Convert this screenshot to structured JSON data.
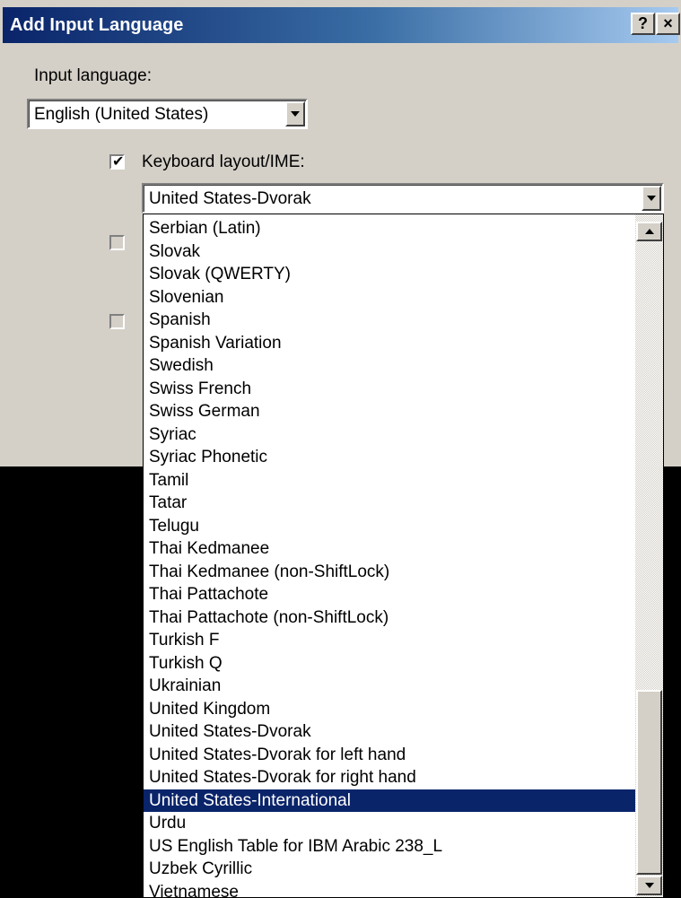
{
  "dialog": {
    "title": "Add Input Language",
    "help_button": "?",
    "close_button": "×"
  },
  "input_language": {
    "label": "Input language:",
    "selected": "English (United States)"
  },
  "keyboard_layout": {
    "label": "Keyboard layout/IME:",
    "checked": true,
    "selected": "United States-Dvorak"
  },
  "dropdown": {
    "items": [
      "Serbian (Latin)",
      "Slovak",
      "Slovak (QWERTY)",
      "Slovenian",
      "Spanish",
      "Spanish Variation",
      "Swedish",
      "Swiss French",
      "Swiss German",
      "Syriac",
      "Syriac Phonetic",
      "Tamil",
      "Tatar",
      "Telugu",
      "Thai Kedmanee",
      "Thai Kedmanee (non-ShiftLock)",
      "Thai Pattachote",
      "Thai Pattachote (non-ShiftLock)",
      "Turkish F",
      "Turkish Q",
      "Ukrainian",
      "United Kingdom",
      "United States-Dvorak",
      "United States-Dvorak for left hand",
      "United States-Dvorak for right hand",
      "United States-International",
      "Urdu",
      "US English Table for IBM Arabic 238_L",
      "Uzbek Cyrillic",
      "Vietnamese"
    ],
    "highlighted_item": "United States-International"
  },
  "colors": {
    "title_bar": "#0a246a",
    "dialog_face": "#d4d0c8",
    "selection": "#0a246a"
  }
}
